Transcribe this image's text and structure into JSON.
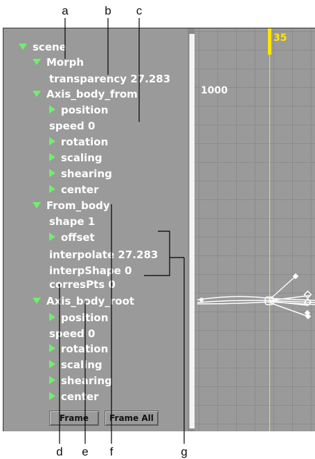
{
  "callouts": [
    "a",
    "b",
    "c",
    "d",
    "e",
    "f",
    "g"
  ],
  "tree": {
    "items": [
      {
        "label": "scene",
        "icon": "expanded-triangle"
      },
      {
        "label": "Morph",
        "icon": "expanded-triangle"
      },
      {
        "label": "transparency 27.283",
        "icon": ""
      },
      {
        "label": "Axis_body_from",
        "icon": "expanded-triangle"
      },
      {
        "label": "position",
        "icon": "collapsed-triangle"
      },
      {
        "label": "speed 0",
        "icon": ""
      },
      {
        "label": "rotation",
        "icon": "collapsed-triangle"
      },
      {
        "label": "scaling",
        "icon": "collapsed-triangle"
      },
      {
        "label": "shearing",
        "icon": "collapsed-triangle"
      },
      {
        "label": "center",
        "icon": "collapsed-triangle"
      },
      {
        "label": "From_body",
        "icon": "expanded-triangle"
      },
      {
        "label": "shape 1",
        "icon": ""
      },
      {
        "label": "offset",
        "icon": "collapsed-triangle"
      },
      {
        "label": "interpolate 27.283",
        "icon": ""
      },
      {
        "label": "interpShape 0",
        "icon": ""
      },
      {
        "label": "corresPts 0",
        "icon": ""
      },
      {
        "label": "Axis_body_root",
        "icon": "expanded-triangle"
      },
      {
        "label": "position",
        "icon": "collapsed-triangle"
      },
      {
        "label": "speed 0",
        "icon": ""
      },
      {
        "label": "rotation",
        "icon": "collapsed-triangle"
      },
      {
        "label": "scaling",
        "icon": "collapsed-triangle"
      },
      {
        "label": "shearing",
        "icon": "collapsed-triangle"
      },
      {
        "label": "center",
        "icon": "collapsed-triangle"
      }
    ]
  },
  "buttons": {
    "frame": "Frame",
    "frame_all": "Frame All"
  },
  "graph": {
    "current_frame": "35",
    "value_label": "1000"
  },
  "colors": {
    "panel": "#9a9a9a",
    "triangle": "#6ff06b",
    "frame_marker": "#ffe600",
    "text": "#ffffff"
  }
}
